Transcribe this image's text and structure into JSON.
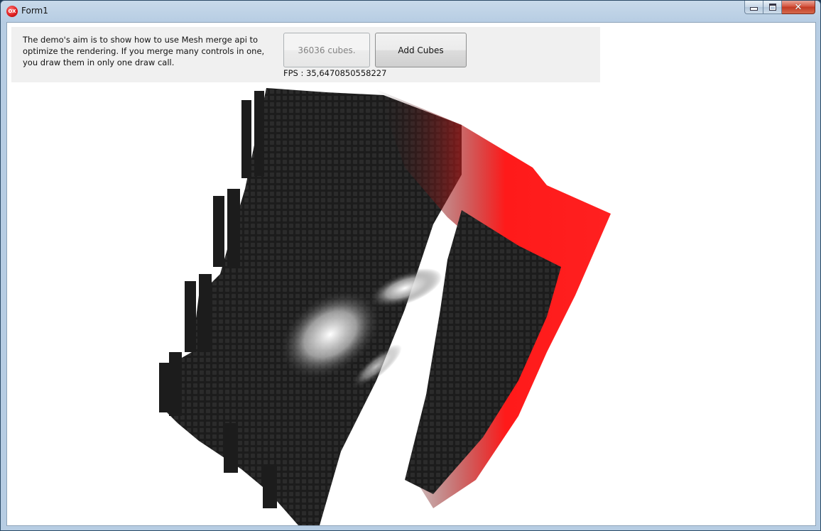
{
  "window": {
    "title": "Form1",
    "icon": "app-icon",
    "controls": [
      "minimize-icon",
      "maximize-icon",
      "close-icon"
    ]
  },
  "panel": {
    "description": "The demo's aim is to show how to use Mesh merge api to optimize the rendering. If you merge many controls in one, you draw them in only one draw call.",
    "cube_count_label": "36036 cubes.",
    "add_button_label": "Add Cubes",
    "fps_text": "FPS : 35,6470850558227"
  },
  "colors": {
    "cube_dark": "#1c1c1c",
    "cube_red": "#ff1a1a",
    "highlight": "#ffffff",
    "panel_bg": "#f0f0f0"
  }
}
